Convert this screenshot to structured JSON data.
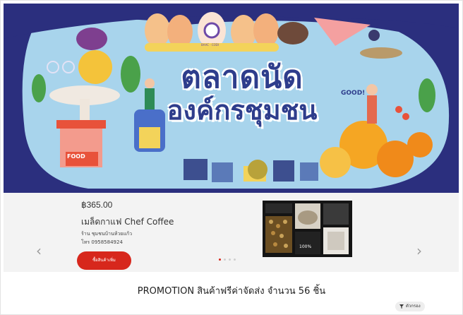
{
  "banner": {
    "title_line1": "ตลาดนัด",
    "title_line2": "องค์กรชุมชน",
    "good_text": "GOOD!",
    "food_text": "FOOD",
    "logo_text": "BAAC · CODI"
  },
  "carousel": {
    "price": "฿365.00",
    "product_name": "เมล็ดกาแฟ Chef Coffee",
    "shop": "ร้าน ชุมชนบ้านห้วยแก้ว",
    "phone": "โทร 0958584924",
    "cta_label": "ซื้อสินค้าเพิ่ม",
    "prev_arrow": "‹",
    "next_arrow": "›",
    "product_image_caption": "100%"
  },
  "promo_text": "PROMOTION สินค้าฟรีค่าจัดส่ง จำนวน 56 ชิ้น",
  "filter_label": "ตัวกรอง",
  "colors": {
    "banner_bg": "#2b2f7e",
    "accent_red": "#d7271c",
    "carousel_bg": "#f3f3f3"
  }
}
